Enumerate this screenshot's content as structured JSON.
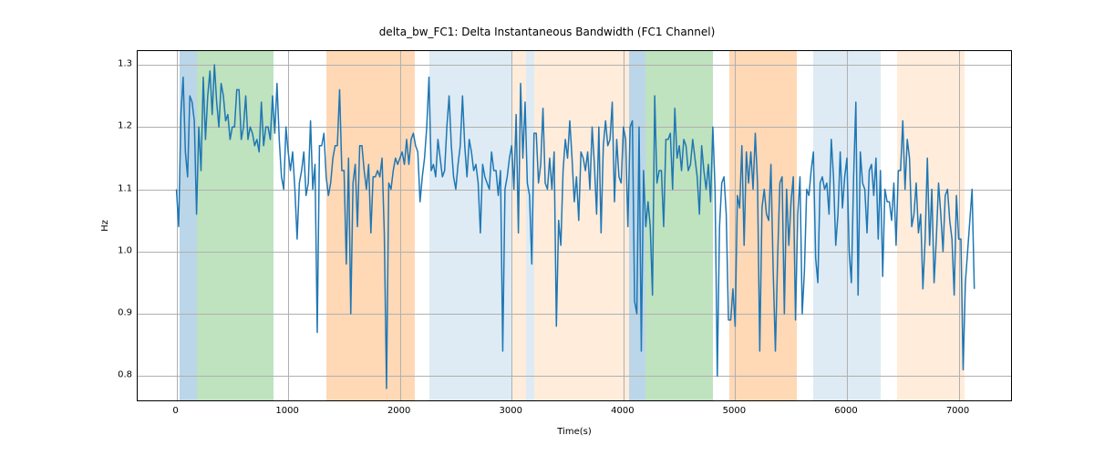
{
  "chart_data": {
    "type": "line",
    "title": "delta_bw_FC1: Delta Instantaneous Bandwidth (FC1 Channel)",
    "xlabel": "Time(s)",
    "ylabel": "Hz",
    "xlim": [
      -347,
      7485
    ],
    "ylim": [
      0.758,
      1.322
    ],
    "xticks": [
      0,
      1000,
      2000,
      3000,
      4000,
      5000,
      6000,
      7000
    ],
    "yticks": [
      0.8,
      0.9,
      1.0,
      1.1,
      1.2,
      1.3
    ],
    "spans": [
      {
        "x0": 30,
        "x1": 180,
        "color": "blue"
      },
      {
        "x0": 180,
        "x1": 870,
        "color": "green"
      },
      {
        "x0": 1340,
        "x1": 2130,
        "color": "orange"
      },
      {
        "x0": 2260,
        "x1": 3010,
        "color": "lblue"
      },
      {
        "x0": 3010,
        "x1": 3130,
        "color": "lorange"
      },
      {
        "x0": 3130,
        "x1": 3200,
        "color": "lblue"
      },
      {
        "x0": 3200,
        "x1": 4050,
        "color": "lorange"
      },
      {
        "x0": 4050,
        "x1": 4200,
        "color": "blue"
      },
      {
        "x0": 4200,
        "x1": 4800,
        "color": "green"
      },
      {
        "x0": 4950,
        "x1": 5550,
        "color": "orange"
      },
      {
        "x0": 5700,
        "x1": 6300,
        "color": "lblue"
      },
      {
        "x0": 6450,
        "x1": 7050,
        "color": "lorange"
      }
    ],
    "x": [
      0,
      20,
      40,
      60,
      80,
      100,
      120,
      140,
      160,
      180,
      200,
      220,
      240,
      260,
      280,
      300,
      320,
      340,
      360,
      380,
      400,
      420,
      440,
      460,
      480,
      500,
      520,
      540,
      560,
      580,
      600,
      620,
      640,
      660,
      680,
      700,
      720,
      740,
      760,
      780,
      800,
      820,
      840,
      860,
      880,
      900,
      920,
      940,
      960,
      980,
      1000,
      1020,
      1040,
      1060,
      1080,
      1100,
      1120,
      1140,
      1160,
      1180,
      1200,
      1220,
      1240,
      1260,
      1280,
      1300,
      1320,
      1340,
      1360,
      1380,
      1400,
      1420,
      1440,
      1460,
      1480,
      1500,
      1520,
      1540,
      1560,
      1580,
      1600,
      1620,
      1640,
      1660,
      1680,
      1700,
      1720,
      1740,
      1760,
      1780,
      1800,
      1820,
      1840,
      1860,
      1880,
      1900,
      1920,
      1940,
      1960,
      1980,
      2000,
      2020,
      2040,
      2060,
      2080,
      2100,
      2120,
      2140,
      2160,
      2180,
      2200,
      2220,
      2240,
      2260,
      2280,
      2300,
      2320,
      2340,
      2360,
      2380,
      2400,
      2420,
      2440,
      2460,
      2480,
      2500,
      2520,
      2540,
      2560,
      2580,
      2600,
      2620,
      2640,
      2660,
      2680,
      2700,
      2720,
      2740,
      2760,
      2780,
      2800,
      2820,
      2840,
      2860,
      2880,
      2900,
      2920,
      2940,
      2960,
      2980,
      3000,
      3020,
      3040,
      3060,
      3080,
      3100,
      3120,
      3140,
      3160,
      3180,
      3200,
      3220,
      3240,
      3260,
      3280,
      3300,
      3320,
      3340,
      3360,
      3380,
      3400,
      3420,
      3440,
      3460,
      3480,
      3500,
      3520,
      3540,
      3560,
      3580,
      3600,
      3620,
      3640,
      3660,
      3680,
      3700,
      3720,
      3740,
      3760,
      3780,
      3800,
      3820,
      3840,
      3860,
      3880,
      3900,
      3920,
      3940,
      3960,
      3980,
      4000,
      4020,
      4040,
      4060,
      4080,
      4100,
      4120,
      4140,
      4160,
      4180,
      4200,
      4220,
      4240,
      4260,
      4280,
      4300,
      4320,
      4340,
      4360,
      4380,
      4400,
      4420,
      4440,
      4460,
      4480,
      4500,
      4520,
      4540,
      4560,
      4580,
      4600,
      4620,
      4640,
      4660,
      4680,
      4700,
      4720,
      4740,
      4760,
      4780,
      4800,
      4820,
      4840,
      4860,
      4880,
      4900,
      4920,
      4940,
      4960,
      4980,
      5000,
      5020,
      5040,
      5060,
      5080,
      5100,
      5120,
      5140,
      5160,
      5180,
      5200,
      5220,
      5240,
      5260,
      5280,
      5300,
      5320,
      5340,
      5360,
      5380,
      5400,
      5420,
      5440,
      5460,
      5480,
      5500,
      5520,
      5540,
      5560,
      5580,
      5600,
      5620,
      5640,
      5660,
      5680,
      5700,
      5720,
      5740,
      5760,
      5780,
      5800,
      5820,
      5840,
      5860,
      5880,
      5900,
      5920,
      5940,
      5960,
      5980,
      6000,
      6020,
      6040,
      6060,
      6080,
      6100,
      6120,
      6140,
      6160,
      6180,
      6200,
      6220,
      6240,
      6260,
      6280,
      6300,
      6320,
      6340,
      6360,
      6380,
      6400,
      6420,
      6440,
      6460,
      6480,
      6500,
      6520,
      6540,
      6560,
      6580,
      6600,
      6620,
      6640,
      6660,
      6680,
      6700,
      6720,
      6740,
      6760,
      6780,
      6800,
      6820,
      6840,
      6860,
      6880,
      6900,
      6920,
      6940,
      6960,
      6980,
      7000,
      7020,
      7040,
      7060,
      7080,
      7100,
      7120,
      7140
    ],
    "y": [
      1.1,
      1.04,
      1.22,
      1.28,
      1.16,
      1.12,
      1.25,
      1.24,
      1.21,
      1.06,
      1.2,
      1.13,
      1.28,
      1.18,
      1.25,
      1.29,
      1.22,
      1.3,
      1.24,
      1.2,
      1.27,
      1.25,
      1.21,
      1.22,
      1.18,
      1.2,
      1.2,
      1.26,
      1.26,
      1.18,
      1.2,
      1.25,
      1.18,
      1.2,
      1.19,
      1.17,
      1.18,
      1.16,
      1.24,
      1.17,
      1.2,
      1.2,
      1.18,
      1.25,
      1.19,
      1.27,
      1.18,
      1.12,
      1.1,
      1.2,
      1.16,
      1.13,
      1.16,
      1.1,
      1.02,
      1.11,
      1.13,
      1.16,
      1.09,
      1.11,
      1.21,
      1.1,
      1.14,
      0.87,
      1.17,
      1.17,
      1.19,
      1.12,
      1.09,
      1.11,
      1.15,
      1.17,
      1.17,
      1.26,
      1.13,
      1.13,
      0.98,
      1.15,
      0.9,
      1.11,
      1.14,
      1.04,
      1.17,
      1.17,
      1.13,
      1.1,
      1.14,
      1.03,
      1.12,
      1.12,
      1.13,
      1.12,
      1.15,
      1.03,
      0.78,
      1.11,
      1.1,
      1.13,
      1.15,
      1.14,
      1.15,
      1.16,
      1.14,
      1.18,
      1.14,
      1.18,
      1.19,
      1.17,
      1.16,
      1.08,
      1.12,
      1.15,
      1.2,
      1.28,
      1.13,
      1.14,
      1.12,
      1.18,
      1.15,
      1.12,
      1.13,
      1.2,
      1.25,
      1.17,
      1.12,
      1.1,
      1.14,
      1.17,
      1.25,
      1.17,
      1.12,
      1.18,
      1.16,
      1.13,
      1.14,
      1.11,
      1.03,
      1.14,
      1.12,
      1.11,
      1.1,
      1.16,
      1.13,
      1.13,
      1.09,
      1.13,
      0.84,
      1.1,
      1.12,
      1.15,
      1.17,
      1.1,
      1.22,
      1.03,
      1.27,
      1.15,
      1.24,
      1.11,
      1.09,
      0.98,
      1.19,
      1.19,
      1.11,
      1.14,
      1.23,
      1.11,
      1.1,
      1.15,
      1.1,
      1.16,
      0.88,
      1.05,
      1.01,
      1.13,
      1.18,
      1.15,
      1.21,
      1.15,
      1.08,
      1.12,
      1.05,
      1.16,
      1.15,
      1.13,
      1.16,
      1.1,
      1.2,
      1.14,
      1.06,
      1.2,
      1.03,
      1.17,
      1.21,
      1.17,
      1.18,
      1.24,
      1.08,
      1.18,
      1.12,
      1.11,
      1.2,
      1.18,
      1.04,
      1.2,
      1.21,
      0.92,
      0.9,
      1.2,
      0.84,
      1.13,
      1.04,
      1.08,
      1.04,
      0.93,
      1.25,
      1.11,
      1.13,
      1.13,
      1.04,
      1.18,
      1.18,
      1.19,
      1.1,
      1.23,
      1.15,
      1.17,
      1.13,
      1.18,
      1.17,
      1.13,
      1.14,
      1.18,
      1.15,
      1.12,
      1.06,
      1.17,
      1.13,
      1.1,
      1.14,
      1.08,
      1.2,
      1.1,
      0.8,
      1.04,
      1.11,
      1.12,
      1.06,
      0.89,
      0.89,
      0.94,
      0.88,
      1.09,
      1.07,
      1.17,
      1.01,
      1.16,
      1.11,
      1.16,
      1.1,
      1.19,
      1.11,
      0.84,
      1.07,
      1.1,
      1.06,
      1.05,
      1.14,
      0.97,
      0.84,
      0.99,
      1.11,
      1.12,
      0.9,
      1.1,
      1.01,
      1.08,
      1.12,
      0.89,
      1.06,
      1.12,
      0.9,
      0.97,
      1.1,
      1.09,
      1.13,
      1.16,
      0.99,
      0.95,
      1.11,
      1.12,
      1.1,
      1.11,
      1.06,
      1.18,
      1.12,
      1.01,
      1.06,
      1.16,
      1.07,
      1.12,
      1.15,
      1.0,
      0.95,
      1.12,
      1.24,
      0.93,
      1.16,
      1.11,
      1.1,
      1.03,
      1.13,
      1.14,
      1.09,
      1.15,
      1.02,
      1.13,
      0.96,
      1.1,
      1.08,
      1.08,
      1.05,
      1.11,
      1.01,
      1.13,
      1.13,
      1.21,
      1.1,
      1.18,
      1.15,
      1.04,
      1.06,
      1.11,
      1.03,
      1.06,
      0.94,
      1.02,
      1.15,
      1.01,
      1.1,
      0.95,
      1.02,
      1.11,
      1.06,
      1.0,
      1.09,
      1.1,
      1.05,
      1.02,
      0.93,
      1.09,
      1.02,
      1.02,
      0.81,
      0.95,
      1.0,
      1.05,
      1.1,
      0.94
    ]
  }
}
